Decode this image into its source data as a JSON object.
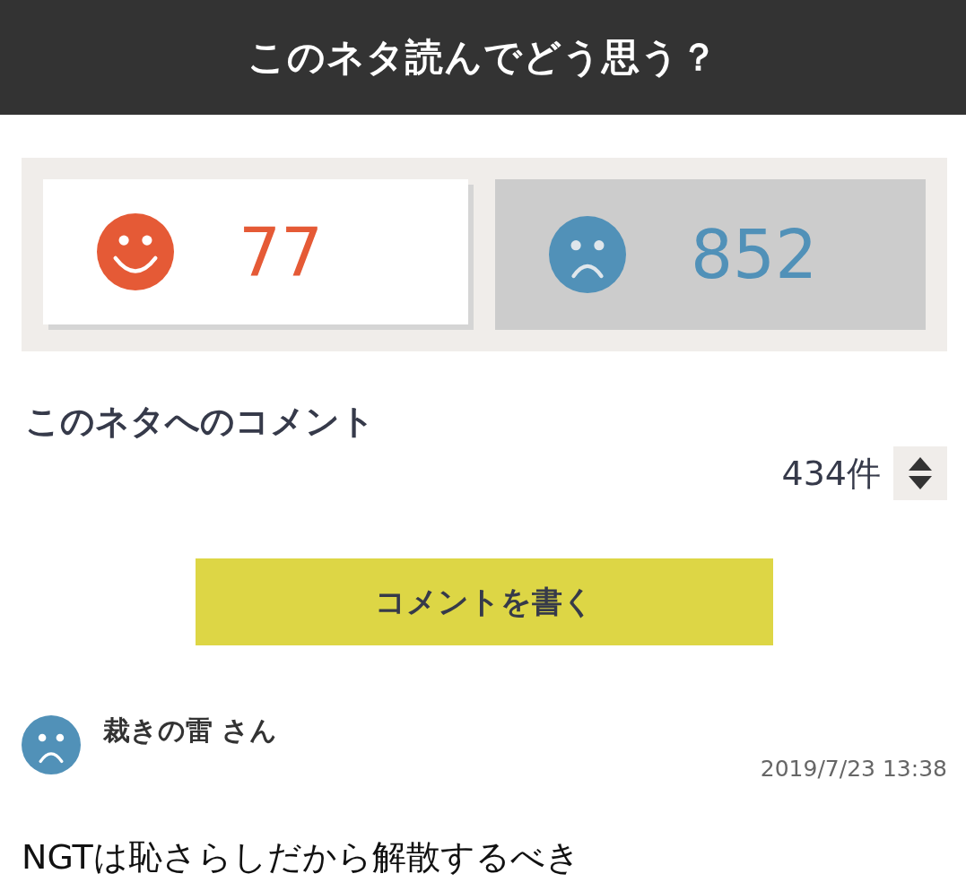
{
  "header": {
    "title": "このネタ読んでどう思う？"
  },
  "votes": [
    {
      "kind": "good",
      "count": "77",
      "color": "#e55a36",
      "selected": false
    },
    {
      "kind": "bad",
      "count": "852",
      "color": "#5191b8",
      "selected": true
    }
  ],
  "comments_section": {
    "heading": "このネタへのコメント",
    "count": "434件",
    "write_button": "コメントを書く"
  },
  "comments": [
    {
      "kind": "bad",
      "author": "裁きの雷 さん",
      "date": "2019/7/23 13:38",
      "text": "NGTは恥さらしだから解散するべき"
    }
  ]
}
